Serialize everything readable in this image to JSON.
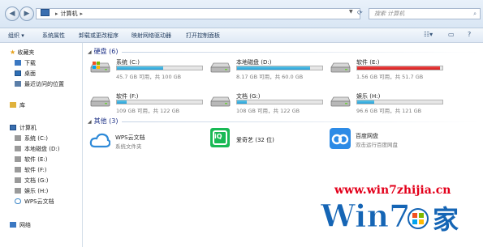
{
  "window": {
    "breadcrumb": [
      "计算机"
    ],
    "search_placeholder": "搜索 计算机"
  },
  "toolbar": {
    "items": [
      "组织 ▾",
      "系统属性",
      "卸载或更改程序",
      "映射网络驱动器",
      "打开控制面板"
    ]
  },
  "sidebar": {
    "favorites_label": "收藏夹",
    "favorites": [
      "下载",
      "桌面",
      "最近访问的位置"
    ],
    "library_label": "库",
    "computer_label": "计算机",
    "computer_items": [
      "系统 (C:)",
      "本地磁盘 (D:)",
      "软件 (E:)",
      "软件 (F:)",
      "文档 (G:)",
      "娱乐 (H:)",
      "WPS云文档"
    ],
    "network_label": "网络"
  },
  "groups": {
    "drives_label": "硬盘 (6)",
    "other_label": "其他 (3)"
  },
  "drives": [
    {
      "name": "系统 (C:)",
      "size": "45.7 GB 可用，共 100 GB",
      "used_fraction": 0.54,
      "color": "#26a0da",
      "system": true
    },
    {
      "name": "本地磁盘 (D:)",
      "size": "8.17 GB 可用，共 60.0 GB",
      "used_fraction": 0.86,
      "color": "#26a0da",
      "system": false
    },
    {
      "name": "软件 (E:)",
      "size": "1.56 GB 可用，共 51.7 GB",
      "used_fraction": 0.97,
      "color": "#d41a1a",
      "system": false
    },
    {
      "name": "软件 (F:)",
      "size": "109 GB 可用，共 122 GB",
      "used_fraction": 0.11,
      "color": "#26a0da",
      "system": false
    },
    {
      "name": "文档 (G:)",
      "size": "108 GB 可用，共 122 GB",
      "used_fraction": 0.11,
      "color": "#26a0da",
      "system": false
    },
    {
      "name": "娱乐 (H:)",
      "size": "96.6 GB 可用，共 121 GB",
      "used_fraction": 0.2,
      "color": "#26a0da",
      "system": false
    }
  ],
  "others": [
    {
      "name": "WPS云文档",
      "sub": "系统文件夹"
    },
    {
      "name": "爱奇艺 (32 位)",
      "sub": ""
    },
    {
      "name": "百度网盘",
      "sub": "双击运行百度网盘"
    }
  ],
  "watermark": {
    "url": "www.win7zhijia.cn",
    "logo_text": "Win7.家"
  }
}
